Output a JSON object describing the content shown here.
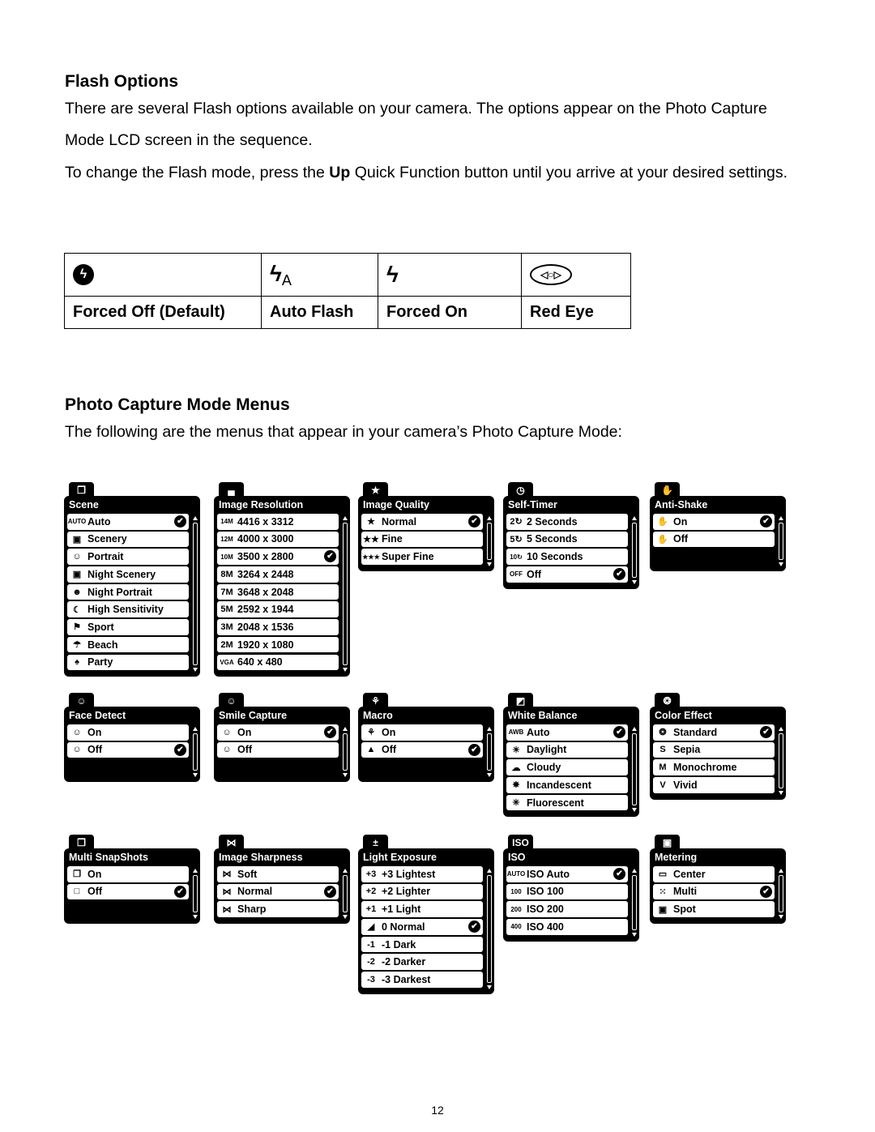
{
  "flash_section": {
    "heading": "Flash Options",
    "para1": "There are several Flash options available on your camera. The options appear on the Photo Capture Mode LCD screen in the sequence.",
    "para2_pre": "To change the Flash mode, press the ",
    "para2_bold": "Up",
    "para2_post": " Quick Function button until you arrive at your desired settings.",
    "table": [
      {
        "icon": "flash-off-icon",
        "glyph": "ϟ",
        "label": "Forced Off (Default)"
      },
      {
        "icon": "flash-auto-icon",
        "glyph": "ϟ",
        "suffix": "A",
        "label": "Auto Flash"
      },
      {
        "icon": "flash-on-icon",
        "glyph": "ϟ",
        "label": "Forced On"
      },
      {
        "icon": "red-eye-icon",
        "glyph": "◁○▷",
        "label": "Red Eye"
      }
    ]
  },
  "menus_section": {
    "heading": "Photo Capture Mode Menus",
    "intro": "The following are the menus that appear in your camera’s Photo Capture Mode:"
  },
  "menus": [
    {
      "title": "Scene",
      "tab_icon": "❐",
      "tab_name": "scene-icon",
      "items": [
        {
          "icon": "AUTO",
          "label": "Auto",
          "selected": true
        },
        {
          "icon": "▣",
          "label": "Scenery"
        },
        {
          "icon": "☺",
          "label": "Portrait"
        },
        {
          "icon": "▣",
          "label": "Night Scenery"
        },
        {
          "icon": "☻",
          "label": "Night Portrait"
        },
        {
          "icon": "☾",
          "label": "High Sensitivity"
        },
        {
          "icon": "⚑",
          "label": "Sport"
        },
        {
          "icon": "☂",
          "label": "Beach"
        },
        {
          "icon": "♠",
          "label": "Party"
        }
      ]
    },
    {
      "title": "Image Resolution",
      "tab_icon": "▄",
      "tab_name": "resolution-icon",
      "items": [
        {
          "icon": "14M",
          "label": "4416 x 3312"
        },
        {
          "icon": "12M",
          "label": "4000 x 3000"
        },
        {
          "icon": "10M",
          "label": "3500 x 2800",
          "selected": true
        },
        {
          "icon": "8M",
          "label": "3264 x 2448"
        },
        {
          "icon": "7M",
          "label": "3648 x 2048"
        },
        {
          "icon": "5M",
          "label": "2592 x 1944"
        },
        {
          "icon": "3M",
          "label": "2048 x 1536"
        },
        {
          "icon": "2M",
          "label": "1920 x 1080"
        },
        {
          "icon": "VGA",
          "label": "640 x 480"
        }
      ]
    },
    {
      "title": "Image Quality",
      "tab_icon": "★",
      "tab_name": "quality-icon",
      "items": [
        {
          "icon": "★",
          "label": "Normal",
          "selected": true
        },
        {
          "icon": "★★",
          "label": "Fine"
        },
        {
          "icon": "★★★",
          "label": "Super Fine"
        }
      ]
    },
    {
      "title": "Self-Timer",
      "tab_icon": "◷",
      "tab_name": "self-timer-icon",
      "items": [
        {
          "icon": "2↻",
          "label": "2 Seconds"
        },
        {
          "icon": "5↻",
          "label": "5 Seconds"
        },
        {
          "icon": "10↻",
          "label": "10 Seconds"
        },
        {
          "icon": "OFF",
          "label": "Off",
          "selected": true
        }
      ]
    },
    {
      "title": "Anti-Shake",
      "tab_icon": "✋",
      "tab_name": "anti-shake-icon",
      "items": [
        {
          "icon": "✋",
          "label": "On",
          "selected": true
        },
        {
          "icon": "✋",
          "label": "Off"
        }
      ]
    },
    {
      "title": "Face Detect",
      "tab_icon": "☺",
      "tab_name": "face-detect-icon",
      "items": [
        {
          "icon": "☺",
          "label": "On"
        },
        {
          "icon": "☺",
          "label": "Off",
          "selected": true
        }
      ]
    },
    {
      "title": "Smile Capture",
      "tab_icon": "☺",
      "tab_name": "smile-capture-icon",
      "items": [
        {
          "icon": "☺",
          "label": "On",
          "selected": true
        },
        {
          "icon": "☺",
          "label": "Off"
        }
      ]
    },
    {
      "title": "Macro",
      "tab_icon": "⚘",
      "tab_name": "macro-icon",
      "items": [
        {
          "icon": "⚘",
          "label": "On"
        },
        {
          "icon": "▲",
          "label": "Off",
          "selected": true
        }
      ]
    },
    {
      "title": "White Balance",
      "tab_icon": "◩",
      "tab_name": "white-balance-icon",
      "items": [
        {
          "icon": "AWB",
          "label": "Auto",
          "selected": true
        },
        {
          "icon": "☀",
          "label": "Daylight"
        },
        {
          "icon": "☁",
          "label": "Cloudy"
        },
        {
          "icon": "✵",
          "label": "Incandescent"
        },
        {
          "icon": "✳",
          "label": "Fluorescent"
        }
      ]
    },
    {
      "title": "Color Effect",
      "tab_icon": "❂",
      "tab_name": "color-effect-icon",
      "items": [
        {
          "icon": "❂",
          "label": "Standard",
          "selected": true
        },
        {
          "icon": "S",
          "label": "Sepia"
        },
        {
          "icon": "M",
          "label": "Monochrome"
        },
        {
          "icon": "V",
          "label": "Vivid"
        }
      ]
    },
    {
      "title": "Multi SnapShots",
      "tab_icon": "❐",
      "tab_name": "multi-snapshots-icon",
      "items": [
        {
          "icon": "❐",
          "label": "On"
        },
        {
          "icon": "□",
          "label": "Off",
          "selected": true
        }
      ]
    },
    {
      "title": "Image Sharpness",
      "tab_icon": "⋈",
      "tab_name": "sharpness-icon",
      "items": [
        {
          "icon": "⋈",
          "label": "Soft"
        },
        {
          "icon": "⋈",
          "label": "Normal",
          "selected": true
        },
        {
          "icon": "⋈",
          "label": "Sharp"
        }
      ]
    },
    {
      "title": "Light Exposure",
      "tab_icon": "±",
      "tab_name": "exposure-icon",
      "items": [
        {
          "icon": "+3",
          "label": "+3 Lightest"
        },
        {
          "icon": "+2",
          "label": "+2 Lighter"
        },
        {
          "icon": "+1",
          "label": "+1 Light"
        },
        {
          "icon": "◢",
          "label": "0 Normal",
          "selected": true
        },
        {
          "icon": "-1",
          "label": "-1 Dark"
        },
        {
          "icon": "-2",
          "label": "-2 Darker"
        },
        {
          "icon": "-3",
          "label": "-3 Darkest"
        }
      ]
    },
    {
      "title": "ISO",
      "tab_icon": "ISO",
      "tab_name": "iso-icon",
      "items": [
        {
          "icon": "AUTO",
          "label": "ISO Auto",
          "selected": true
        },
        {
          "icon": "100",
          "label": "ISO 100"
        },
        {
          "icon": "200",
          "label": "ISO 200"
        },
        {
          "icon": "400",
          "label": "ISO 400"
        }
      ]
    },
    {
      "title": "Metering",
      "tab_icon": "▣",
      "tab_name": "metering-icon",
      "items": [
        {
          "icon": "▭",
          "label": "Center"
        },
        {
          "icon": "⁙",
          "label": "Multi",
          "selected": true
        },
        {
          "icon": "▣",
          "label": "Spot"
        }
      ]
    }
  ],
  "check_glyph": "✔",
  "page_number": "12"
}
